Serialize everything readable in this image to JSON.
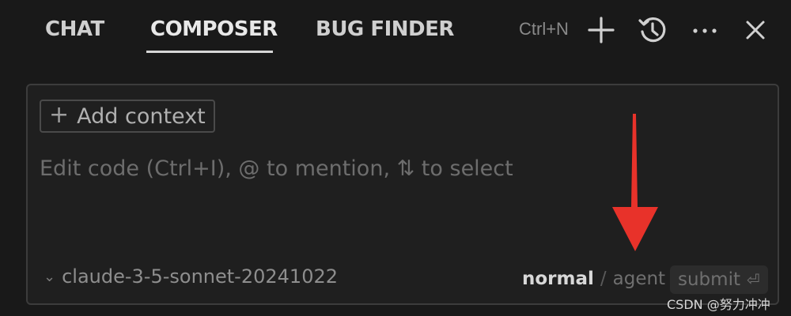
{
  "tabs": [
    {
      "label": "CHAT",
      "active": false
    },
    {
      "label": "COMPOSER",
      "active": true
    },
    {
      "label": "BUG FINDER",
      "active": false
    }
  ],
  "toolbar": {
    "new_shortcut": "Ctrl+N",
    "icons": [
      "plus-icon",
      "history-icon",
      "more-icon",
      "close-icon"
    ]
  },
  "composer": {
    "add_context_label": "Add context",
    "input_placeholder": "Edit code (Ctrl+I), @ to mention, ⇅ to select",
    "input_value": "",
    "model_name": "claude-3-5-sonnet-20241022",
    "mode_normal": "normal",
    "mode_separator": "/",
    "mode_agent": "agent",
    "submit_label": "submit",
    "submit_glyph": "⏎"
  },
  "annotation": {
    "color": "#e8322a"
  },
  "watermark": "CSDN @努力冲冲",
  "colors": {
    "background": "#191919",
    "panel": "#1f1f1f",
    "border": "#3c3c3c"
  }
}
